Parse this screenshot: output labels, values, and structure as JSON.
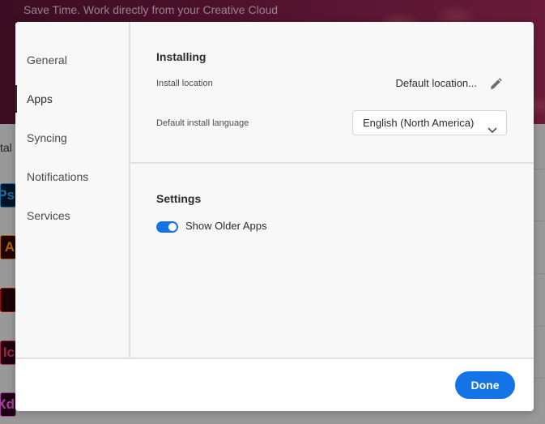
{
  "background": {
    "banner_text": "Save Time. Work directly from your Creative Cloud",
    "partial_label": "tal",
    "app_icons": [
      {
        "text": "Ps",
        "bg": "#001e36",
        "fg": "#31a8ff"
      },
      {
        "text": "A",
        "bg": "#330000",
        "fg": "#ff9a00"
      },
      {
        "text": "",
        "bg": "#2a0000",
        "fg": "#fa0f00"
      },
      {
        "text": "Ic",
        "bg": "#2b0017",
        "fg": "#ff3366"
      },
      {
        "text": "Xd",
        "bg": "#2e001f",
        "fg": "#ff61f6"
      }
    ]
  },
  "modal": {
    "sidebar": {
      "items": [
        {
          "label": "General",
          "active": false
        },
        {
          "label": "Apps",
          "active": true
        },
        {
          "label": "Syncing",
          "active": false
        },
        {
          "label": "Notifications",
          "active": false
        },
        {
          "label": "Services",
          "active": false
        }
      ]
    },
    "installing": {
      "title": "Installing",
      "install_location_label": "Install location",
      "install_location_value": "Default location...",
      "edit_icon": "pencil-icon",
      "language_label": "Default install language",
      "language_value": "English (North America)",
      "dropdown_icon": "chevron-down-icon"
    },
    "settings": {
      "title": "Settings",
      "show_older_apps_label": "Show Older Apps",
      "show_older_apps_enabled": true
    },
    "footer": {
      "done_label": "Done"
    }
  },
  "colors": {
    "accent": "#1473e6",
    "text": "#2c2c2c",
    "muted_text": "#4b4b4b"
  }
}
